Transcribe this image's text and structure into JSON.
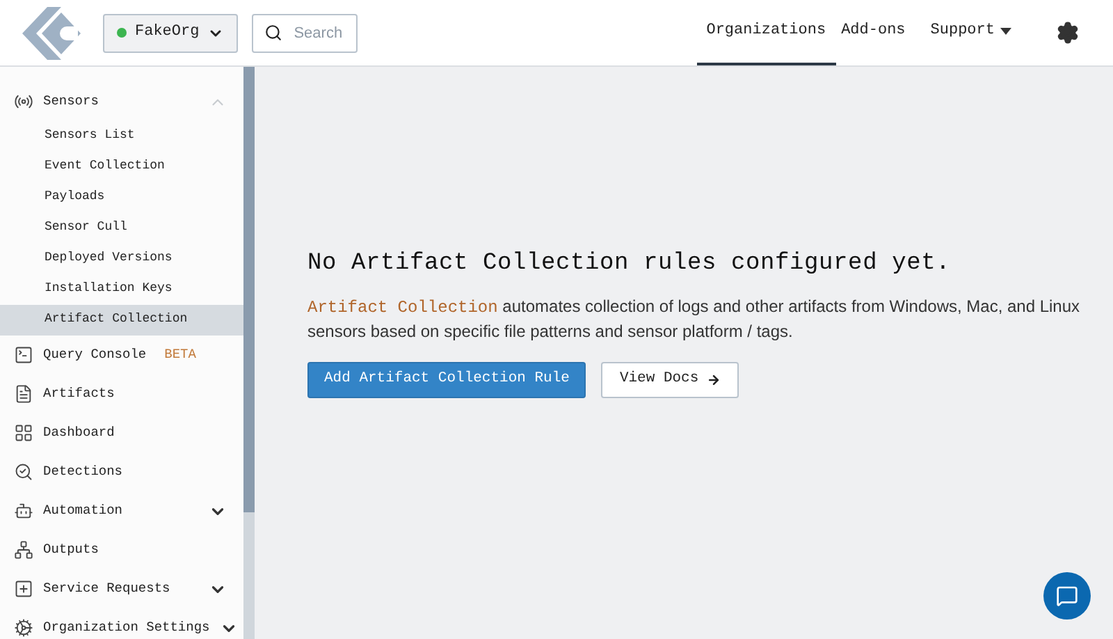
{
  "header": {
    "org_selector": {
      "label": "FakeOrg",
      "color": "#3cb550"
    },
    "search": {
      "placeholder": "Search"
    },
    "nav": [
      {
        "label": "Organizations",
        "selected": true,
        "kind": "link"
      },
      {
        "label": "Add-ons",
        "selected": false,
        "kind": "link"
      },
      {
        "label": "Support",
        "selected": false,
        "kind": "dropdown"
      }
    ]
  },
  "sidebar": {
    "items": [
      {
        "label": "Sensors",
        "expanded": true,
        "children": [
          {
            "label": "Sensors List",
            "selected": false
          },
          {
            "label": "Event Collection",
            "selected": false
          },
          {
            "label": "Payloads",
            "selected": false
          },
          {
            "label": "Sensor Cull",
            "selected": false
          },
          {
            "label": "Deployed Versions",
            "selected": false
          },
          {
            "label": "Installation Keys",
            "selected": false
          },
          {
            "label": "Artifact Collection",
            "selected": true
          }
        ]
      },
      {
        "label": "Query Console",
        "badge": "BETA"
      },
      {
        "label": "Artifacts"
      },
      {
        "label": "Dashboard"
      },
      {
        "label": "Detections"
      },
      {
        "label": "Automation",
        "expanded": false
      },
      {
        "label": "Outputs"
      },
      {
        "label": "Service Requests",
        "expanded": false
      },
      {
        "label": "Organization Settings",
        "expanded": false
      }
    ]
  },
  "main": {
    "title": "No Artifact Collection rules configured yet.",
    "description_link": "Artifact Collection",
    "description": " automates collection of logs and other artifacts from Windows, Mac, and Linux sensors based on specific file patterns and sensor platform / tags.",
    "buttons": [
      {
        "label": "Add Artifact Collection Rule",
        "kind": "primary"
      },
      {
        "label": "View Docs",
        "kind": "secondary"
      }
    ]
  }
}
